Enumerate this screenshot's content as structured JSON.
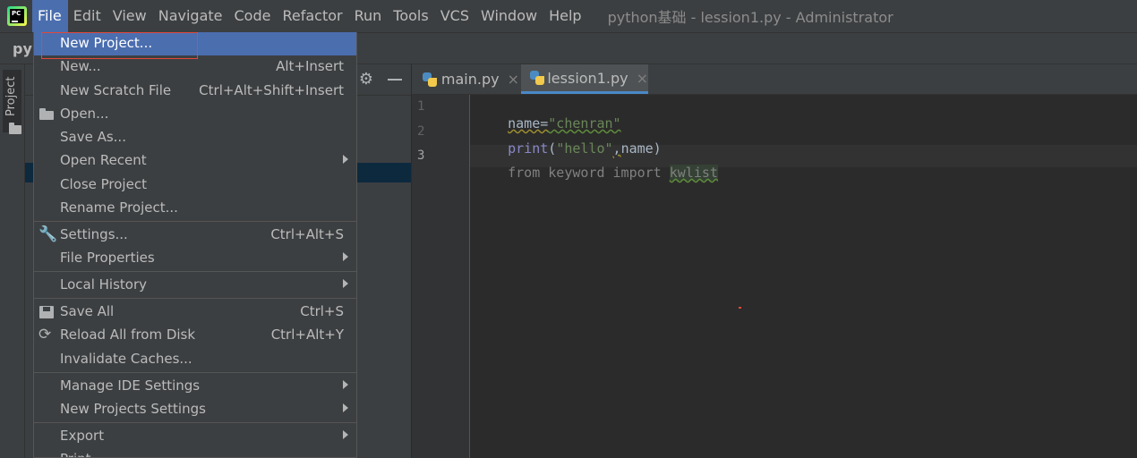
{
  "menubar": {
    "items": [
      {
        "label": "File",
        "mnemonic_index": 0
      },
      {
        "label": "Edit"
      },
      {
        "label": "View"
      },
      {
        "label": "Navigate"
      },
      {
        "label": "Code"
      },
      {
        "label": "Refactor"
      },
      {
        "label": "Run"
      },
      {
        "label": "Tools"
      },
      {
        "label": "VCS"
      },
      {
        "label": "Window"
      },
      {
        "label": "Help"
      }
    ],
    "window_title": "python基础 - lession1.py - Administrator"
  },
  "navbar": {
    "crumb": "py"
  },
  "tool_window": {
    "project_label": "Project"
  },
  "tabs": [
    {
      "label": "main.py",
      "close": "×"
    },
    {
      "label": "lession1.py",
      "close": "×"
    }
  ],
  "editor": {
    "line_numbers": [
      "1",
      "2",
      "3"
    ],
    "lines": {
      "l1_a": "name=",
      "l1_b": "\"chenran\"",
      "l2_a": "print",
      "l2_b": "(",
      "l2_c": "\"hello\"",
      "l2_d": ",",
      "l2_e": "name)",
      "l3_a": "from keyword import ",
      "l3_b": "kwlist"
    }
  },
  "file_menu": {
    "new_project": "New Project...",
    "new": "New...",
    "new_shortcut": "Alt+Insert",
    "new_scratch": "New Scratch File",
    "new_scratch_shortcut": "Ctrl+Alt+Shift+Insert",
    "open": "Open...",
    "save_as": "Save As...",
    "open_recent": "Open Recent",
    "close_project": "Close Project",
    "rename_project": "Rename Project...",
    "settings": "Settings...",
    "settings_shortcut": "Ctrl+Alt+S",
    "file_properties": "File Properties",
    "local_history": "Local History",
    "save_all": "Save All",
    "save_all_shortcut": "Ctrl+S",
    "reload": "Reload All from Disk",
    "reload_shortcut": "Ctrl+Alt+Y",
    "invalidate": "Invalidate Caches...",
    "manage_ide": "Manage IDE Settings",
    "new_projects_settings": "New Projects Settings",
    "export": "Export",
    "print": "Print..."
  },
  "colors": {
    "accent": "#4b6eaf",
    "highlight_box": "#e0483b",
    "background": "#2b2b2b",
    "panel": "#3c3f41"
  },
  "icons": [
    "pycharm-logo-icon",
    "gear-icon",
    "minimize-icon",
    "python-file-icon",
    "close-icon",
    "folder-open-icon",
    "wrench-icon",
    "save-icon",
    "reload-icon",
    "submenu-arrow-icon"
  ]
}
